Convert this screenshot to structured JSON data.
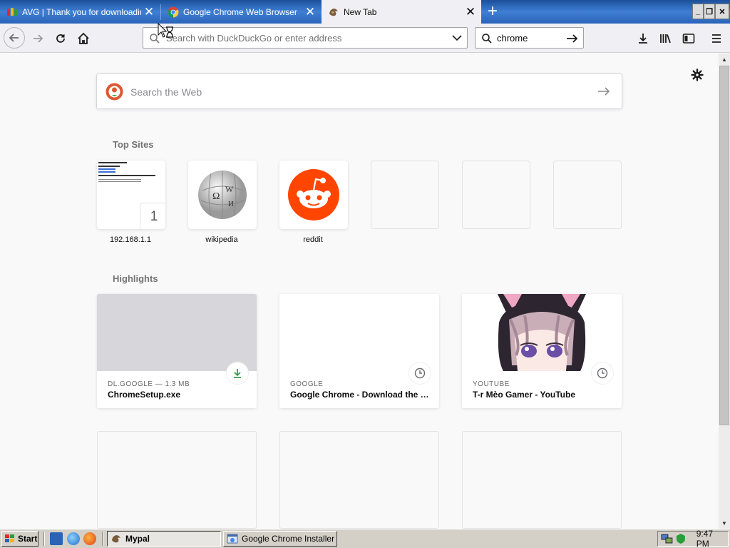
{
  "tabs": [
    {
      "title": "AVG | Thank you for downloading",
      "icon": "avg-icon",
      "selected": false
    },
    {
      "title": "Google Chrome Web Browser",
      "icon": "chrome-icon",
      "selected": false
    },
    {
      "title": "New Tab",
      "icon": "firefox-newtab-icon",
      "selected": true
    }
  ],
  "urlbar": {
    "placeholder": "Search with DuckDuckGo or enter address",
    "value": ""
  },
  "searchbar": {
    "value": "chrome"
  },
  "web_search": {
    "placeholder": "Search the Web"
  },
  "top_sites": {
    "heading": "Top Sites",
    "items": [
      {
        "label": "192.168.1.1",
        "pin_number": "1"
      },
      {
        "label": "wikipedia"
      },
      {
        "label": "reddit"
      }
    ]
  },
  "highlights": {
    "heading": "Highlights",
    "items": [
      {
        "context": "DL.GOOGLE — 1.3 MB",
        "title": "ChromeSetup.exe",
        "badge": "download-icon"
      },
      {
        "context": "GOOGLE",
        "title": "Google Chrome - Download the Fast, Secure Browser from Google",
        "badge": "clock-icon"
      },
      {
        "context": "YOUTUBE",
        "title": "T-r Mèo Gamer - YouTube",
        "badge": "clock-icon"
      }
    ]
  },
  "taskbar": {
    "start_label": "Start",
    "windows": [
      {
        "label": "Mypal",
        "pressed": true
      },
      {
        "label": "Google Chrome Installer",
        "pressed": false
      }
    ],
    "clock": "9:47 PM"
  },
  "colors": {
    "tabstrip": "#2a63b8",
    "reddit": "#ff4500",
    "download_green": "#30a14e",
    "taskbar": "#d4d0c8"
  }
}
